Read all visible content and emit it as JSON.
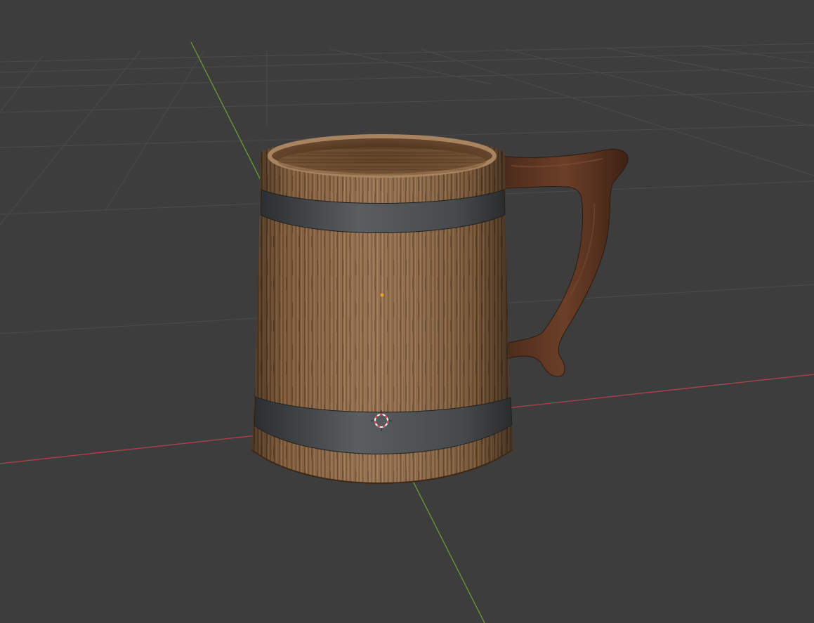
{
  "viewport": {
    "background_color": "#3d3d3d",
    "grid_line_color": "#4a4a4a",
    "x_axis_color": "#b0414f",
    "y_axis_color": "#6a9c37",
    "cursor_color": "#e04040",
    "origin_color": "#f0a020"
  },
  "object": {
    "name_icon": "wooden-mug-model",
    "wood_color": "#8a6441",
    "wood_dark_color": "#5a3a22",
    "band_color": "#4e5152",
    "handle_color": "#5b3524"
  }
}
